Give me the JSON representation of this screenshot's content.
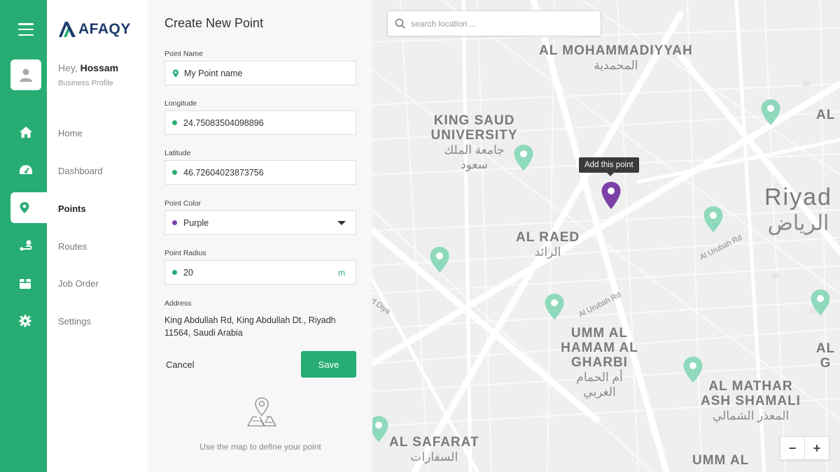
{
  "sidebar": {
    "brand": "AFAQY",
    "greeting_prefix": "Hey,",
    "user_name": "Hossam",
    "profile_type": "Business Profile",
    "nav": [
      {
        "label": "Home",
        "icon": "home-icon"
      },
      {
        "label": "Dashboard",
        "icon": "dashboard-icon"
      },
      {
        "label": "Points",
        "icon": "location-pin-icon",
        "active": true
      },
      {
        "label": "Routes",
        "icon": "route-icon"
      },
      {
        "label": "Job Order",
        "icon": "box-icon"
      },
      {
        "label": "Settings",
        "icon": "gear-icon"
      }
    ]
  },
  "form": {
    "title": "Create New Point",
    "point_name_label": "Point Name",
    "point_name_value": "My Point name",
    "longitude_label": "Longitude",
    "longitude_value": "24.75083504098896",
    "latitude_label": "Latitude",
    "latitude_value": "46.72604023873756",
    "color_label": "Point Color",
    "color_value": "Purple",
    "radius_label": "Point Radius",
    "radius_value": "20",
    "radius_unit": "m",
    "address_label": "Address",
    "address_value": "King Abdullah Rd, King Abdullah Dt., Riyadh 11564, Saudi Arabia",
    "cancel_label": "Cancel",
    "save_label": "Save",
    "hint": "Use the map to define your point"
  },
  "map": {
    "search_placeholder": "search location ...",
    "tooltip": "Add this point",
    "areas": [
      {
        "en": "AL MOHAMMADIYYAH",
        "ar": "المحمدية"
      },
      {
        "en": "KING SAUD UNIVERSITY",
        "ar": "جامعة الملك سعود"
      },
      {
        "en": "AL RAED",
        "ar": "الرائد"
      },
      {
        "en": "UMM AL HAMAM AL GHARBI",
        "ar": "أم الحمام الغربي"
      },
      {
        "en": "AL MATHAR ASH SHAMALI",
        "ar": "المعذر الشمالي"
      },
      {
        "en": "AL SAFARAT",
        "ar": "السفارات"
      },
      {
        "en": "Riyad",
        "ar": "الرياض"
      },
      {
        "en": "UMM AL",
        "ar": ""
      },
      {
        "en": "AL",
        "ar": ""
      },
      {
        "en": "AL G",
        "ar": ""
      }
    ],
    "roads": [
      "Al Urubah Rd",
      "Al Urubah Rd",
      "d Diya"
    ],
    "zoom_out": "−",
    "zoom_in": "+"
  },
  "colors": {
    "brand_green": "#27ad74",
    "selected_pin": "#7b3fa8",
    "map_pins": "#8fd9bc"
  }
}
